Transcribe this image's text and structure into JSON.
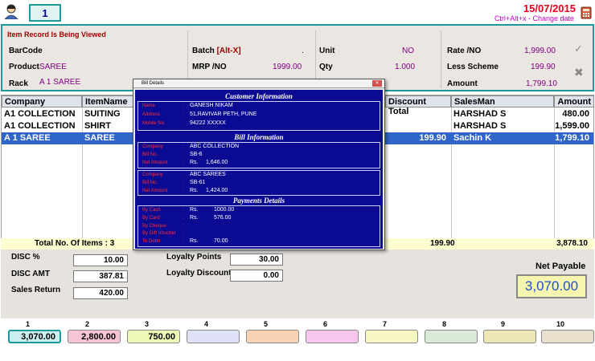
{
  "header": {
    "counter": "1",
    "date": "15/07/2015",
    "date_hint": "Ctrl+Alt+x - Change date"
  },
  "record": {
    "title": "Item Record Is Being Viewed",
    "barcode_label": "BarCode",
    "product_label": "Product",
    "product_value": "SAREE",
    "rack_label": "Rack",
    "rack_value": "A 1 SAREE",
    "batch_label": "Batch",
    "batch_hint": "[Alt-X]",
    "batch_value": ".",
    "mrp_label": "MRP /NO",
    "mrp_value": "1999.00",
    "unit_label": "Unit",
    "unit_value": "NO",
    "qty_label": "Qty",
    "qty_value": "1.000",
    "rate_label": "Rate /NO",
    "rate_value": "1,999.00",
    "less_label": "Less Scheme",
    "less_value": "199.90",
    "amount_label": "Amount",
    "amount_value": "1,799.10"
  },
  "grid": {
    "headers": [
      "Company",
      "ItemName",
      "Discount Total",
      "SalesMan",
      "Amount"
    ],
    "rows": [
      {
        "company": "A1 COLLECTION",
        "item": "SUITING",
        "discount": "",
        "salesman": "HARSHAD S",
        "amount": "480.00"
      },
      {
        "company": "A1 COLLECTION",
        "item": "SHIRT",
        "discount": "",
        "salesman": "HARSHAD S",
        "amount": "1,599.00"
      },
      {
        "company": "A 1 SAREE",
        "item": "SAREE",
        "discount": "199.90",
        "salesman": "Sachin K",
        "amount": "1,799.10"
      }
    ]
  },
  "totals": {
    "items_label": "Total No. Of Items :",
    "items_count": "3",
    "discount_total": "199.90",
    "amount_total": "3,878.10"
  },
  "bottom": {
    "disc_pct_label": "DISC %",
    "disc_pct_value": "10.00",
    "disc_amt_label": "DISC AMT",
    "disc_amt_value": "387.81",
    "sales_return_label": "Sales Return",
    "sales_return_value": "420.00",
    "loyalty_points_label": "Loyalty  Points",
    "loyalty_points_value": "30.00",
    "loyalty_discount_label": "Loyalty  Discount",
    "loyalty_discount_value": "0.00",
    "net_payable_label": "Net Payable",
    "net_payable_value": "3,070.00"
  },
  "slots": [
    {
      "num": "1",
      "value": "3,070.00",
      "color": "#cdeeee"
    },
    {
      "num": "2",
      "value": "2,800.00",
      "color": "#f7c3d6"
    },
    {
      "num": "3",
      "value": "750.00",
      "color": "#eef7b8"
    },
    {
      "num": "4",
      "value": "",
      "color": "#dfe2f7"
    },
    {
      "num": "5",
      "value": "",
      "color": "#f8d2b3"
    },
    {
      "num": "6",
      "value": "",
      "color": "#f7c6ec"
    },
    {
      "num": "7",
      "value": "",
      "color": "#f7f7c3"
    },
    {
      "num": "8",
      "value": "",
      "color": "#d9ead6"
    },
    {
      "num": "9",
      "value": "",
      "color": "#eee6b6"
    },
    {
      "num": "10",
      "value": "",
      "color": "#e8dfcc"
    }
  ],
  "dialog": {
    "title": "Bill Details",
    "customer_title": "Customer Information",
    "name_label": "Name",
    "name_value": "GANESH NIKAM",
    "address_label": "Address",
    "address_value": "51,RAVIVAR PETH, PUNE",
    "mobile_label": "Mobile No.",
    "mobile_value": "94222 XXXXX",
    "bill_title": "Bill Information",
    "bills": [
      {
        "company_label": "Company",
        "company": "ABC COLLECTION",
        "billno_label": "Bill No.",
        "billno": "SB-6",
        "net_label": "Net Amount",
        "currency": "Rs.",
        "net": "1,646.00"
      },
      {
        "company_label": "Company",
        "company": "ABC SAREES",
        "billno_label": "Bill No.",
        "billno": "SB-61",
        "net_label": "Net Amount",
        "currency": "Rs.",
        "net": "1,424.00"
      }
    ],
    "payments_title": "Payments Details",
    "cash_label": "By Cash",
    "cash_cur": "Rs.",
    "cash_value": "1000.00",
    "card_label": "By Card",
    "card_cur": "Rs.",
    "card_value": "576.00",
    "cheque_label": "By Cheque",
    "voucher_label": "By Gift Voucher",
    "debit_label": "To Debit",
    "debit_cur": "Rs.",
    "debit_value": "70.00"
  }
}
